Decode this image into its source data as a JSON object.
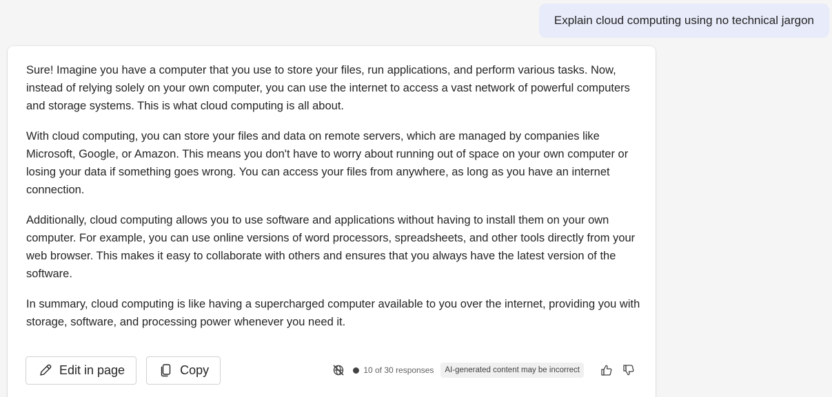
{
  "user_message": {
    "text": "Explain cloud computing using no technical jargon"
  },
  "response": {
    "paragraphs": [
      "Sure! Imagine you have a computer that you use to store your files, run applications, and perform various tasks. Now, instead of relying solely on your own computer, you can use the internet to access a vast network of powerful computers and storage systems. This is what cloud computing is all about.",
      "With cloud computing, you can store your files and data on remote servers, which are managed by companies like Microsoft, Google, or Amazon. This means you don't have to worry about running out of space on your own computer or losing your data if something goes wrong. You can access your files from anywhere, as long as you have an internet connection.",
      "Additionally, cloud computing allows you to use software and applications without having to install them on your own computer. For example, you can use online versions of word processors, spreadsheets, and other tools directly from your web browser. This makes it easy to collaborate with others and ensures that you always have the latest version of the software.",
      "In summary, cloud computing is like having a supercharged computer available to you over the internet, providing you with storage, software, and processing power whenever you need it."
    ]
  },
  "actions": {
    "edit_label": "Edit in page",
    "edit_icon": "pencil-icon",
    "copy_label": "Copy",
    "copy_icon": "copy-icon"
  },
  "meta": {
    "response_count": "10 of 30 responses",
    "disclaimer": "AI-generated content may be incorrect",
    "icons": [
      "no-web-search-icon",
      "thumbs-up-icon",
      "thumbs-down-icon"
    ]
  },
  "colors": {
    "user_bubble_bg": "#e8ebfa",
    "card_bg": "#ffffff",
    "page_bg": "#f5f5f5",
    "text": "#242424"
  }
}
